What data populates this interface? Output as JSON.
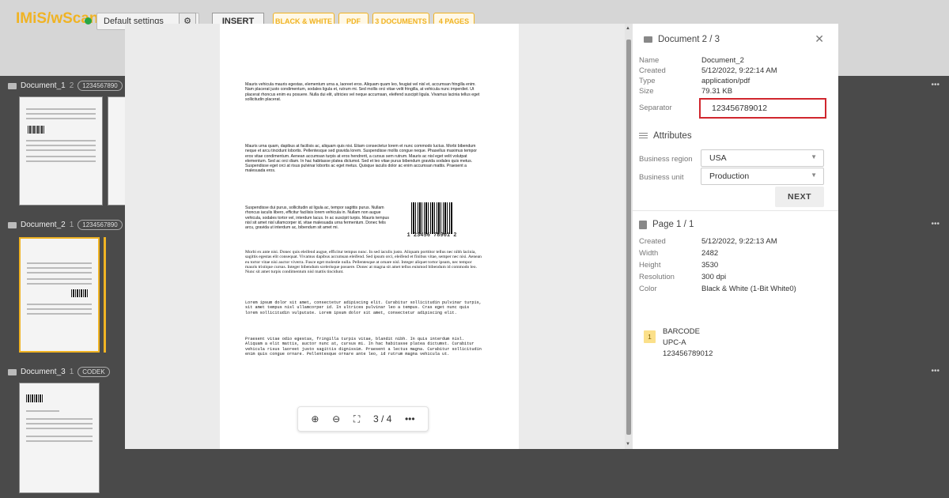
{
  "app": {
    "brand": "IMiS/wScan",
    "settings_select": "Default settings",
    "insert_label": "INSERT",
    "chips": [
      "BLACK & WHITE",
      "PDF",
      "3 DOCUMENTS",
      "4 PAGES"
    ]
  },
  "documents": [
    {
      "name": "Document_1",
      "count": "2",
      "badge": "1234567890"
    },
    {
      "name": "Document_2",
      "count": "1",
      "badge": "1234567890"
    },
    {
      "name": "Document_3",
      "count": "1",
      "badge": "CODEK"
    }
  ],
  "preview": {
    "paragraphs": [
      "Mauris vehicula mauris egestas, elementum urna a, laoreet eros. Aliquam quam leo, feugiat vel nisl et, accumsan fringilla enim. Nam placerat justo condimentum, sodales ligula et, rutrum mi. Sed mollis orci vitae velit fringilla, at vehicula nunc imperdiet. Ut placerat rhoncus enim eu posuere. Nulla dui elit, ultricies vel neque accumsan, eleifend suscipit ligula. Vivamus lacinia tellus eget sollicitudin placerat.",
      "Mauris urna quam, dapibus at facilisis ac, aliquam quis nisi. Etiam consectetur lorem et nunc commodo luctus. Morbi bibendum neque et arcu tincidunt lobortis. Pellentesque sed gravida lorem. Suspendisse mollis congue neque. Phasellus maximus tempor eros vitae condimentum. Aenean accumsan turpis at eros hendrerit, a cursus sem rutrum. Mauris ac nisl eget velit volutpat elementum. Sed ac orci diam. In hac habitasse platea dictumst. Sed et leo vitae purus bibendum gravida sodales quis metus. Suspendisse eget orci at risus pulvinar lobortis ac eget metus. Quisque iaculis dolor ac enim accumsan mattis. Praesent a malesuada eros.",
      "Suspendisse dui purus, sollicitudin at ligula ac, tempor sagittis purus. Nullam rhoncus iaculis libero, efficitur facilisis lorem vehicula in. Nullam non augue vehicula, sodales tortor vel, interdum lacus. In ac suscipit turpis. Mauris tempus nisl sit amet nisl ullamcorper id, vitae malesuada urna fermentum. Donec felis arcu, gravida ut interdum ac, bibendum sit amet mi.",
      "Morbi ex ante nisi. Donec quis eleifend augue, efficitur tempus nunc. In sed iaculis justo. Aliquam porttitor tellus nec nibh lacinia, sagittis egestas elit consequat. Vivamus dapibus accumsan eleifend. Sed ipsum orci, eleifend et finibus vitae, semper nec nisi. Aenean eu tortor vitae nisi auctor viverra. Fusce eget molestie nulla. Pellentesque at ornare nisl. Integer aliquet tortor ipsum, nec tempor mauris tristique cursus. Integer bibendum scelerisque posuere. Donec at magna sit amet tellus euismod bibendum id commodo leo. Nunc sit amet turpis condimentum nisl mattis tincidunt.",
      "Lorem ipsum dolor sit amet, consectetur adipiscing elit. Curabitur sollicitudin pulvinar turpis, sit amet tempus nisl ullamcorper id. In ultrices pulvinar leo a tempus. Cras eget nunc quis lorem sollicitudin vulputate. Lorem ipsum dolor sit amet, consectetur adipiscing elit.",
      "Praesent vitae odio egestas, fringilla turpis vitae, blandit nibh. In quis interdum nisl. Aliquam a elit mattis, auctor nunc at, cursus mi. In hac habitasse platea dictumst. Curabitur vehicula risus laoreet justo sagittis dignissim. Praesent a lectus magna. Curabitur sollicitudin enim quis congue ornare. Pellentesque ornare ante leo, id rutrum magna vehicula ut."
    ],
    "barcode_text": "1 23456 78901 2",
    "page_indicator": "3 / 4",
    "more": "•••"
  },
  "panel": {
    "title": "Document 2 / 3",
    "close": "✕",
    "doc_fields": [
      {
        "key": "Name",
        "value": "Document_2"
      },
      {
        "key": "Created",
        "value": "5/12/2022, 9:22:14 AM"
      },
      {
        "key": "Type",
        "value": "application/pdf"
      },
      {
        "key": "Size",
        "value": "79.31 KB"
      }
    ],
    "separator_label": "Separator",
    "separator_value": "123456789012",
    "attributes_title": "Attributes",
    "business_region_label": "Business region",
    "business_region_value": "USA",
    "business_unit_label": "Business unit",
    "business_unit_value": "Production",
    "next_label": "NEXT",
    "page_title": "Page 1 / 1",
    "page_fields": [
      {
        "key": "Created",
        "value": "5/12/2022, 9:22:13 AM"
      },
      {
        "key": "Width",
        "value": "2482"
      },
      {
        "key": "Height",
        "value": "3530"
      },
      {
        "key": "Resolution",
        "value": "300 dpi"
      },
      {
        "key": "Color",
        "value": "Black & White (1-Bit White0)"
      }
    ],
    "barcode_index": "1",
    "barcode_label": "BARCODE",
    "barcode_type": "UPC-A",
    "barcode_value": "123456789012"
  },
  "colors": {
    "accent": "#f0b323",
    "highlight_red": "#d0262e",
    "status_green": "#28a745"
  }
}
